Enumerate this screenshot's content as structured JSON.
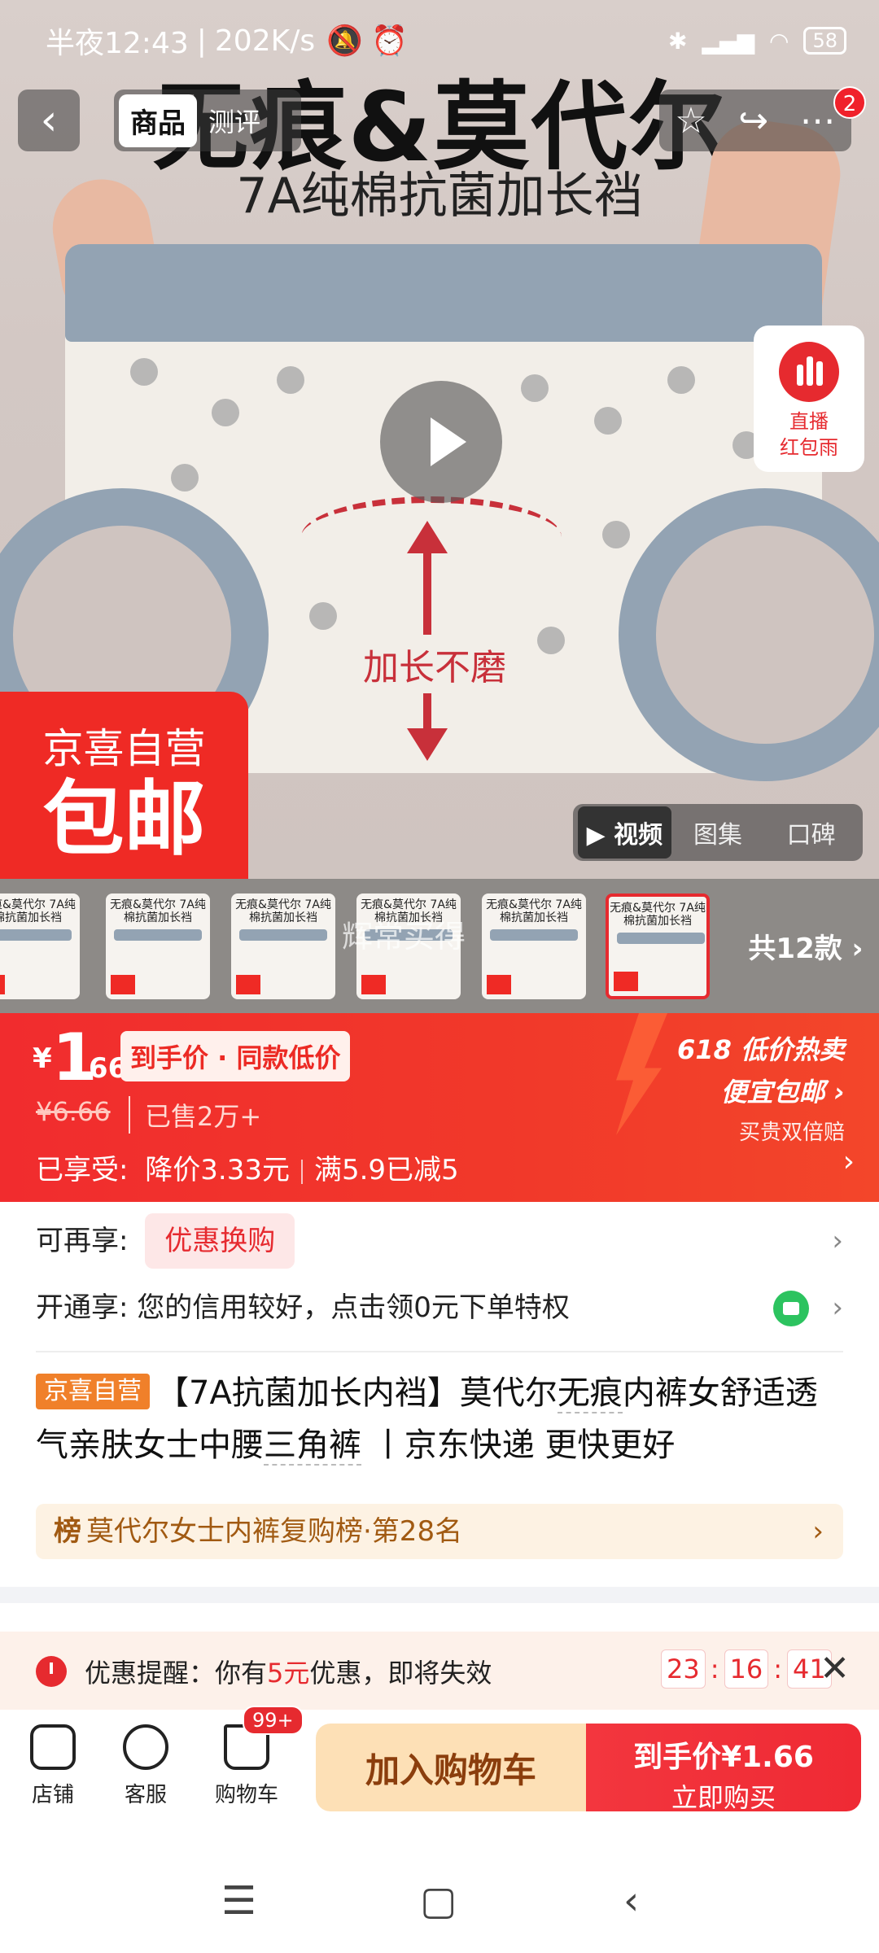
{
  "status": {
    "time": "半夜12:43",
    "speed": "202K/s",
    "battery": "58"
  },
  "hero": {
    "title": "无痕&莫代尔",
    "subtitle": "7A纯棉抗菌加长裆",
    "annotation": "加长不磨",
    "badge_line1": "京喜自营",
    "badge_line2": "包邮",
    "tab_product": "商品",
    "tab_review": "测评",
    "notif_count": "2",
    "live_line1": "直播",
    "live_line2": "红包雨",
    "media_tabs": [
      "▶ 视频",
      "图集",
      "口碑"
    ]
  },
  "thumbs": {
    "text": "无痕&莫代尔 7A纯棉抗菌加长裆",
    "watermark": "辉常买得",
    "more": "共12款 ›"
  },
  "price": {
    "currency": "¥",
    "int": "1",
    "dec": ".66",
    "tag": "到手价 · 同款低价",
    "original": "¥6.66",
    "sold": "已售2万+",
    "promo_label": "已享受:",
    "promo_1": "降价3.33元",
    "promo_2": "满5.9已减5",
    "event_1": "618 低价热卖",
    "event_2": "便宜包邮 ›",
    "event_3": "买贵双倍赔"
  },
  "rows": {
    "extra_label": "可再享:",
    "extra_pill": "优惠换购",
    "open_label": "开通享:",
    "open_text": "您的信用较好，点击领0元下单特权"
  },
  "product_title": {
    "tag": "京喜自营",
    "p1": "【7A抗菌",
    "p2": "加长内裆】莫代尔",
    "p3": "无痕",
    "p4": "内裤女舒适透气亲肤女士中腰",
    "p5": "三角裤",
    "p6": " 丨京东快递 更快更好"
  },
  "rank": {
    "icon": "榜",
    "text": "莫代尔女士内裤复购榜·第28名"
  },
  "reminder": {
    "prefix": "优惠提醒：你有",
    "amount": "5元",
    "suffix": "优惠，即将失效",
    "hh": "23",
    "mm": "16",
    "ss": "41"
  },
  "bottom": {
    "shop": "店铺",
    "service": "客服",
    "cart": "购物车",
    "cart_count": "99+",
    "add_cart": "加入购物车",
    "buy_line1": "到手价¥1.66",
    "buy_line2": "立即购买"
  },
  "colors": {
    "accent": "#ef2a25",
    "cart_btn": "#fde0b6",
    "rank_bg": "#fdf2e3"
  }
}
